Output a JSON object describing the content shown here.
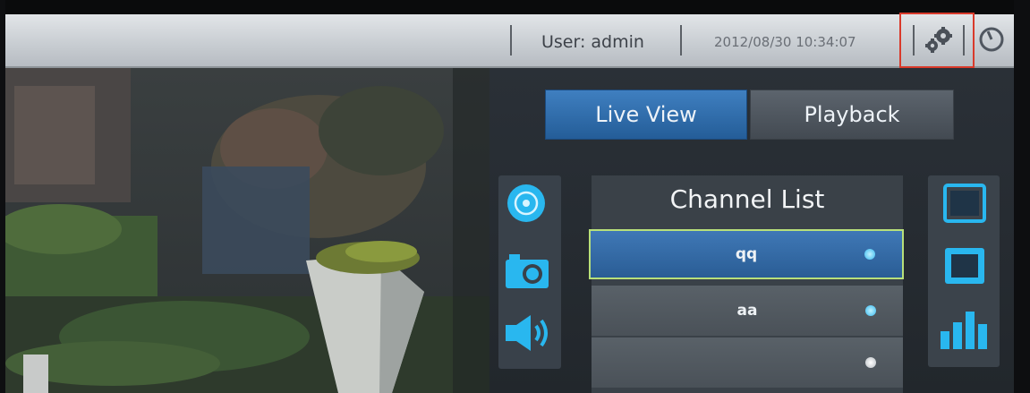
{
  "topbar": {
    "user_label": "User: admin",
    "datetime": "2012/08/30 10:34:07",
    "settings_icon": "gears-icon",
    "logout_icon": "power-icon"
  },
  "tabs": [
    {
      "label": "Live View",
      "active": true
    },
    {
      "label": "Playback",
      "active": false
    }
  ],
  "left_tools": [
    "record-icon",
    "snapshot-camera-icon",
    "speaker-icon"
  ],
  "channel_list": {
    "title": "Channel List",
    "items": [
      {
        "label": "qq",
        "selected": true,
        "status_color": "#38b9ef"
      },
      {
        "label": "aa",
        "selected": false,
        "status_color": "#38b9ef"
      },
      {
        "label": "",
        "selected": false,
        "status_color": "#b9bec3"
      }
    ]
  },
  "right_tools": [
    "single-view-icon",
    "quad-view-icon",
    "bar-chart-icon"
  ],
  "colors": {
    "accent_blue": "#2f6faf",
    "highlight_border": "#b8e07a",
    "settings_highlight": "#d93a2b"
  }
}
